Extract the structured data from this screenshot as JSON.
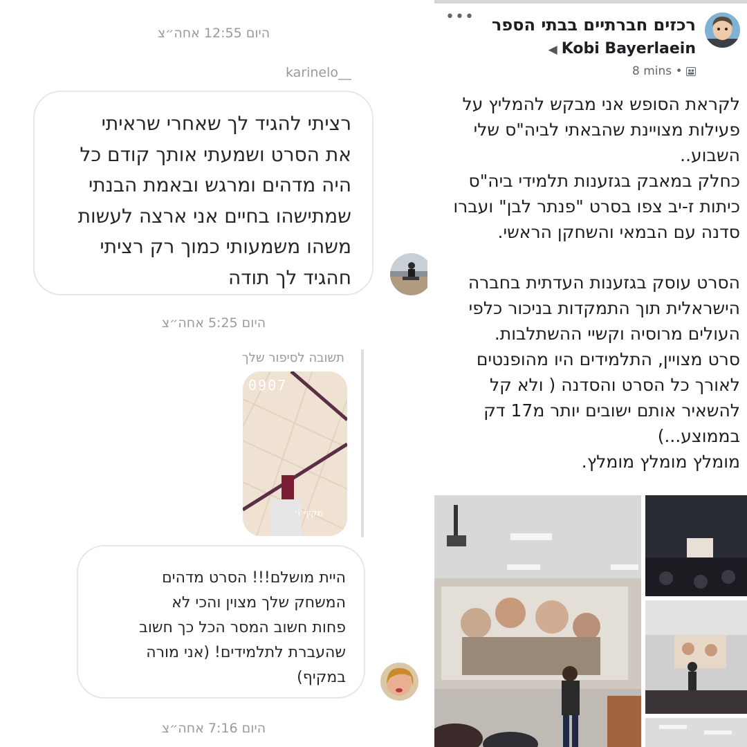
{
  "chat": {
    "timestamp_1": "היום 12:55 אחה״צ",
    "sender_username": "karinelo__",
    "message_1_lines": [
      "רציתי להגיד לך שאחרי שראיתי",
      "את הסרט ושמעתי אותך קודם כל",
      "היה מדהים ומרגש ובאמת הבנתי",
      "שמתישהו בחיים אני ארצה לעשות",
      "משהו משמעותי כמוך רק רציתי",
      "חהגיד לך תודה"
    ],
    "timestamp_2": "היום 5:25 אחה״צ",
    "story_reply_label": "תשובה לסיפור שלך",
    "story_digits": "0907",
    "story_tag": "מקיף ו׳",
    "message_2_lines": [
      "היית מושלם!!! הסרט מדהים",
      "המשחק שלך מצוין והכי לא",
      "פחות חשוב המסר הכל כך חשוב",
      "שהעברת לתלמידים! (אני מורה",
      "במקיף)"
    ],
    "timestamp_3": "היום 7:16 אחה״צ"
  },
  "post": {
    "group_name": "רכזים חברתיים בבתי הספר",
    "author_name": "Kobi Bayerlaein",
    "author_arrow": "◀",
    "time": "8 mins",
    "privacy_icon": "group-privacy-icon",
    "more_label": "•••",
    "text_lines": [
      "לקראת הסופש אני מבקש להמליץ על",
      "פעילות מצויינת שהבאתי לביה\"ס שלי",
      "השבוע..",
      "כחלק במאבק בגזענות תלמידי ביה\"ס",
      "כיתות ז-יב צפו בסרט \"פנתר לבן\" ועברו",
      "סדנה עם הבמאי והשחקן הראשי.",
      "",
      "הסרט עוסק בגזענות העדתית בחברה",
      "הישראלית תוך התמקדות בניכור כלפי",
      "העולים מרוסיה וקשיי ההשתלבות.",
      "סרט מצויין, התלמידים היו מהופנטים",
      "לאורך כל הסרט והסדנה ( ולא קל",
      "להשאיר אותם ישובים יותר מ17 דק",
      "בממוצע...)",
      "מומלץ מומלץ מומלץ."
    ]
  },
  "colors": {
    "bubble_border": "#e6e6e6",
    "meta_gray": "#9a9a9a",
    "fb_text": "#1c1e21",
    "fb_meta": "#606770"
  }
}
